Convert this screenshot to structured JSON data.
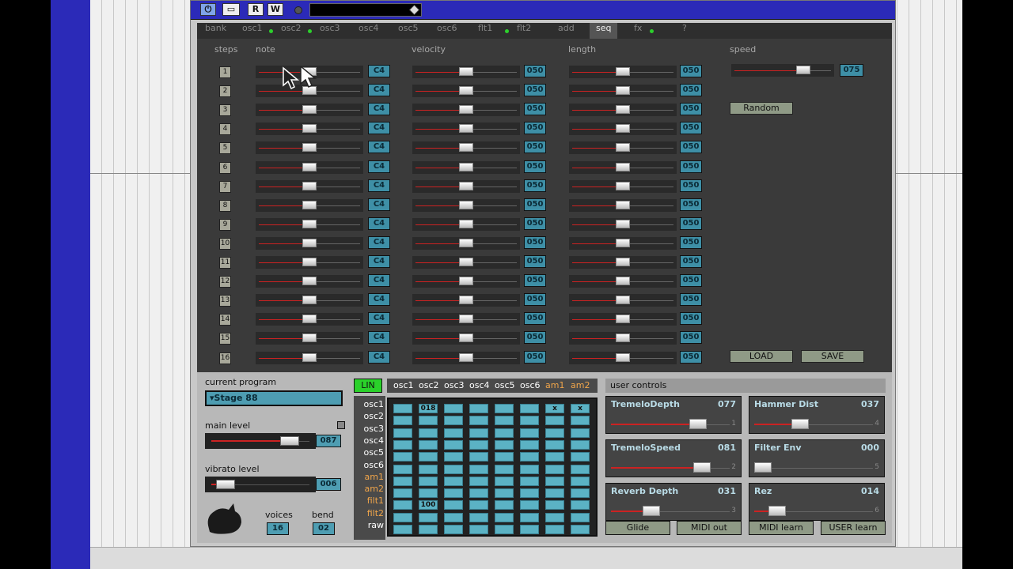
{
  "titlebar": {
    "buttons": [
      "R",
      "W"
    ]
  },
  "tabs": [
    {
      "label": "bank",
      "led": false
    },
    {
      "label": "osc1",
      "led": true
    },
    {
      "label": "osc2",
      "led": true
    },
    {
      "label": "osc3",
      "led": false
    },
    {
      "label": "osc4",
      "led": false
    },
    {
      "label": "osc5",
      "led": false
    },
    {
      "label": "osc6",
      "led": false
    },
    {
      "label": "flt1",
      "led": true
    },
    {
      "label": "flt2",
      "led": false
    },
    {
      "label": "add",
      "led": false
    },
    {
      "label": "seq",
      "led": false
    },
    {
      "label": "fx",
      "led": true
    },
    {
      "label": "?",
      "led": false
    }
  ],
  "seq": {
    "headers": {
      "steps": "steps",
      "note": "note",
      "velocity": "velocity",
      "length": "length",
      "speed": "speed"
    },
    "step_numbers": [
      "1",
      "2",
      "3",
      "4",
      "5",
      "6",
      "7",
      "8",
      "9",
      "10",
      "11",
      "12",
      "13",
      "14",
      "15",
      "16"
    ],
    "note_value": "C4",
    "velocity_value": "050",
    "length_value": "050",
    "note_level": 0.5,
    "velocity_level": 0.5,
    "length_level": 0.5,
    "speed_value": "075",
    "speed_level": 0.75,
    "random_label": "Random",
    "load_label": "LOAD",
    "save_label": "SAVE"
  },
  "lower": {
    "current_program_label": "current program",
    "program_value": "Stage 88",
    "main_level_label": "main level",
    "main_level_value": "087",
    "main_level": 0.87,
    "vibrato_level_label": "vibrato level",
    "vibrato_level_value": "006",
    "vibrato_level": 0.06,
    "voices_label": "voices",
    "voices_value": "16",
    "bend_label": "bend",
    "bend_value": "02",
    "lin_label": "LIN",
    "matrix_cols": [
      "osc1",
      "osc2",
      "osc3",
      "osc4",
      "osc5",
      "osc6",
      "am1",
      "am2"
    ],
    "matrix_rows": [
      "osc1",
      "osc2",
      "osc3",
      "osc4",
      "osc5",
      "osc6",
      "am1",
      "am2",
      "filt1",
      "filt2",
      "raw"
    ],
    "matrix_values": {
      "0-1": "018",
      "0-6": "x",
      "0-7": "x",
      "8-1": "100"
    },
    "user_controls_label": "user controls",
    "user_controls": [
      {
        "name": "TremeloDepth",
        "value": "077",
        "idx": "1",
        "level": 0.77
      },
      {
        "name": "Hammer Dist",
        "value": "037",
        "idx": "4",
        "level": 0.37
      },
      {
        "name": "TremeloSpeed",
        "value": "081",
        "idx": "2",
        "level": 0.81
      },
      {
        "name": "Filter Env",
        "value": "000",
        "idx": "5",
        "level": 0.0
      },
      {
        "name": "Reverb Depth",
        "value": "031",
        "idx": "3",
        "level": 0.31
      },
      {
        "name": "Rez",
        "value": "014",
        "idx": "6",
        "level": 0.14
      }
    ],
    "buttons": [
      "Glide",
      "MIDI out",
      "MIDI learn",
      "USER learn"
    ]
  },
  "colors": {
    "display": "#3e8fa6",
    "panel": "#3a3a3a",
    "titlebar": "#2b2ab8",
    "led": "#2cd02c",
    "accent_orange": "#f0a54a"
  }
}
